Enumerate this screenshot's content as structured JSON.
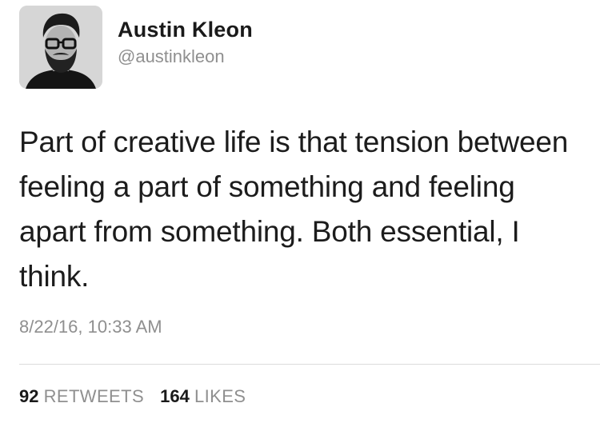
{
  "author": {
    "display_name": "Austin Kleon",
    "handle": "@austinkleon",
    "avatar_icon": "profile-photo"
  },
  "tweet": {
    "text": "Part of creative life is that tension between feeling a part of something and feeling apart from something. Both essential, I think.",
    "timestamp": "8/22/16, 10:33 AM"
  },
  "stats": {
    "retweets_count": "92",
    "retweets_label": "RETWEETS",
    "likes_count": "164",
    "likes_label": "LIKES"
  },
  "colors": {
    "text": "#1a1a1a",
    "secondary": "#8f8f8f",
    "divider": "#dcdcdc"
  }
}
